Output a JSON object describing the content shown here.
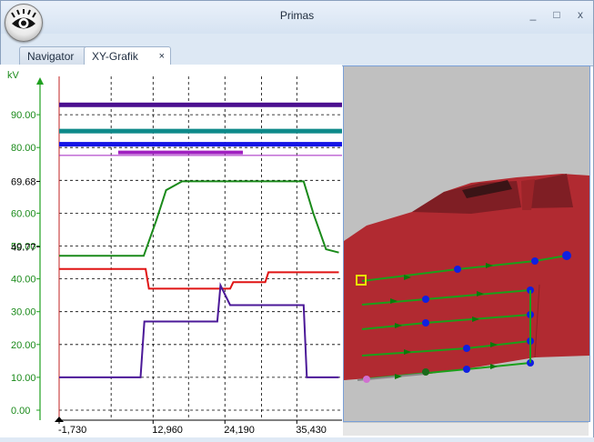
{
  "window": {
    "title": "Primas",
    "minimize_glyph": "_",
    "maximize_glyph": "□",
    "close_glyph": "x"
  },
  "tabs": [
    {
      "label": "Navigator",
      "active": false
    },
    {
      "label": "XY-Grafik",
      "active": true,
      "close_glyph": "×"
    }
  ],
  "chart_data": {
    "type": "line",
    "ylabel": "kV",
    "y_ticks": [
      "90.00",
      "80.00",
      "69.68",
      "60.00",
      "50.00",
      "49.77",
      "40.00",
      "30.00",
      "20.00",
      "10.00",
      "0.00"
    ],
    "x_ticks": [
      "-1,730",
      "12,960",
      "24,190",
      "35,430"
    ],
    "bars": [
      {
        "color": "#4b0f8f",
        "y": 93
      },
      {
        "color": "#0e8a8a",
        "y": 85
      },
      {
        "color": "#1414e6",
        "y": 81
      },
      {
        "color": "#a020c0",
        "y": 78.5
      }
    ],
    "series": [
      {
        "color": "#1a8a1a",
        "points": [
          [
            -1730,
            47
          ],
          [
            11500,
            47
          ],
          [
            13500,
            58
          ],
          [
            15000,
            67
          ],
          [
            17500,
            69.7
          ],
          [
            36500,
            69.7
          ],
          [
            38000,
            60
          ],
          [
            40000,
            49
          ],
          [
            42000,
            48
          ]
        ]
      },
      {
        "color": "#e01414",
        "points": [
          [
            -1730,
            43
          ],
          [
            11800,
            43
          ],
          [
            12300,
            37
          ],
          [
            25000,
            37
          ],
          [
            25500,
            39
          ],
          [
            30500,
            39
          ],
          [
            31000,
            42
          ],
          [
            42000,
            42
          ]
        ]
      },
      {
        "color": "#4b1898",
        "points": [
          [
            -1730,
            10
          ],
          [
            11000,
            10
          ],
          [
            11600,
            27
          ],
          [
            23000,
            27
          ],
          [
            23500,
            38
          ],
          [
            25000,
            32
          ],
          [
            36500,
            32
          ],
          [
            37000,
            10
          ],
          [
            42000,
            10
          ]
        ]
      }
    ]
  },
  "scene": {
    "car_color": "#b22830",
    "path_color": "#1aa01a",
    "point_color": "#1020e0"
  }
}
